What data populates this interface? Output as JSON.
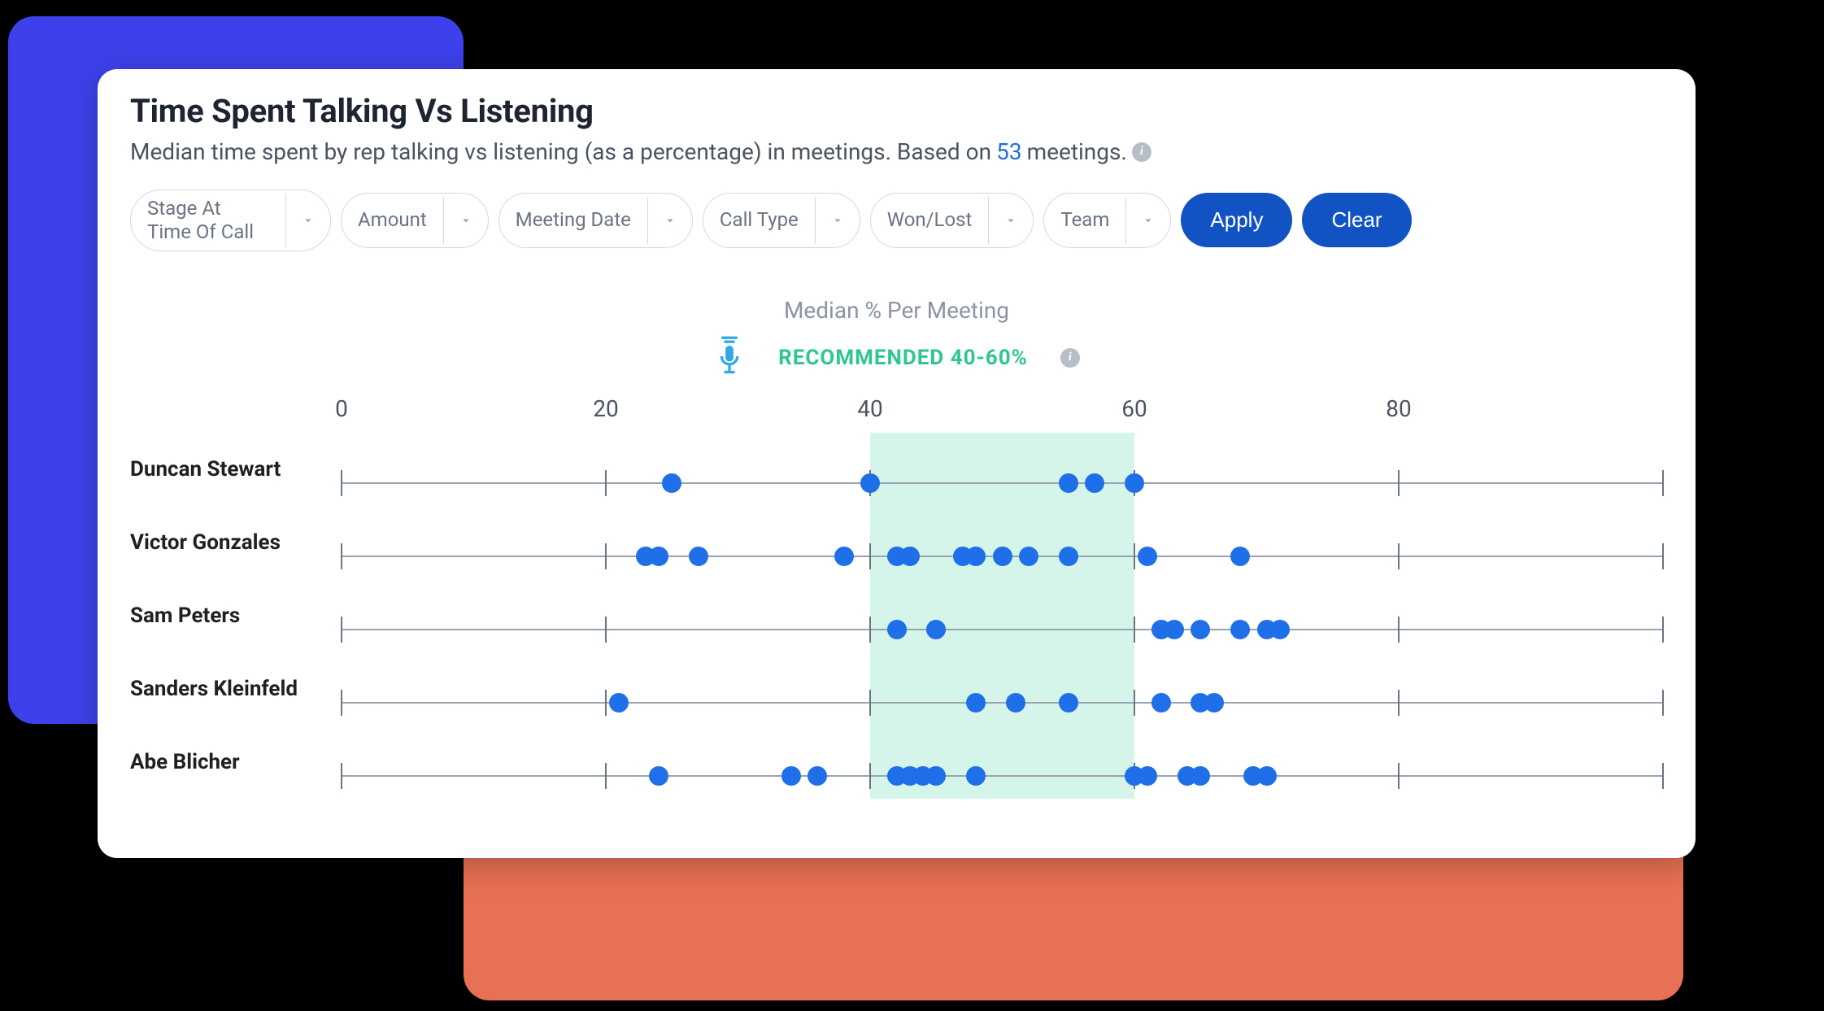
{
  "header": {
    "title": "Time Spent Talking Vs Listening",
    "subtitle_prefix": "Median time spent by rep talking vs listening (as a percentage) in meetings. Based on",
    "meeting_count": "53",
    "subtitle_suffix": "meetings."
  },
  "filters": {
    "items": [
      {
        "label": "Stage At Time Of Call"
      },
      {
        "label": "Amount"
      },
      {
        "label": "Meeting Date"
      },
      {
        "label": "Call Type"
      },
      {
        "label": "Won/Lost"
      },
      {
        "label": "Team"
      }
    ],
    "apply_label": "Apply",
    "clear_label": "Clear"
  },
  "chart_header": {
    "title": "Median % Per Meeting",
    "recommended": "RECOMMENDED 40-60%"
  },
  "chart_data": {
    "type": "scatter",
    "xlabel": "Median % Per Meeting",
    "x_ticks": [
      0,
      20,
      40,
      60,
      80,
      100
    ],
    "x_tick_labels": [
      "0",
      "20",
      "40",
      "60",
      "80"
    ],
    "recommended_band": [
      40,
      60
    ],
    "series": [
      {
        "name": "Duncan Stewart",
        "values": [
          25,
          40,
          55,
          57,
          60
        ]
      },
      {
        "name": "Victor Gonzales",
        "values": [
          23,
          24,
          27,
          38,
          42,
          43,
          47,
          48,
          50,
          52,
          55,
          61,
          68
        ]
      },
      {
        "name": "Sam Peters",
        "values": [
          42,
          45,
          62,
          63,
          65,
          68,
          70,
          71
        ]
      },
      {
        "name": "Sanders Kleinfeld",
        "values": [
          21,
          48,
          51,
          55,
          62,
          65,
          66
        ]
      },
      {
        "name": "Abe Blicher",
        "values": [
          24,
          34,
          36,
          42,
          43,
          44,
          45,
          48,
          60,
          61,
          64,
          65,
          69,
          70
        ]
      }
    ]
  }
}
